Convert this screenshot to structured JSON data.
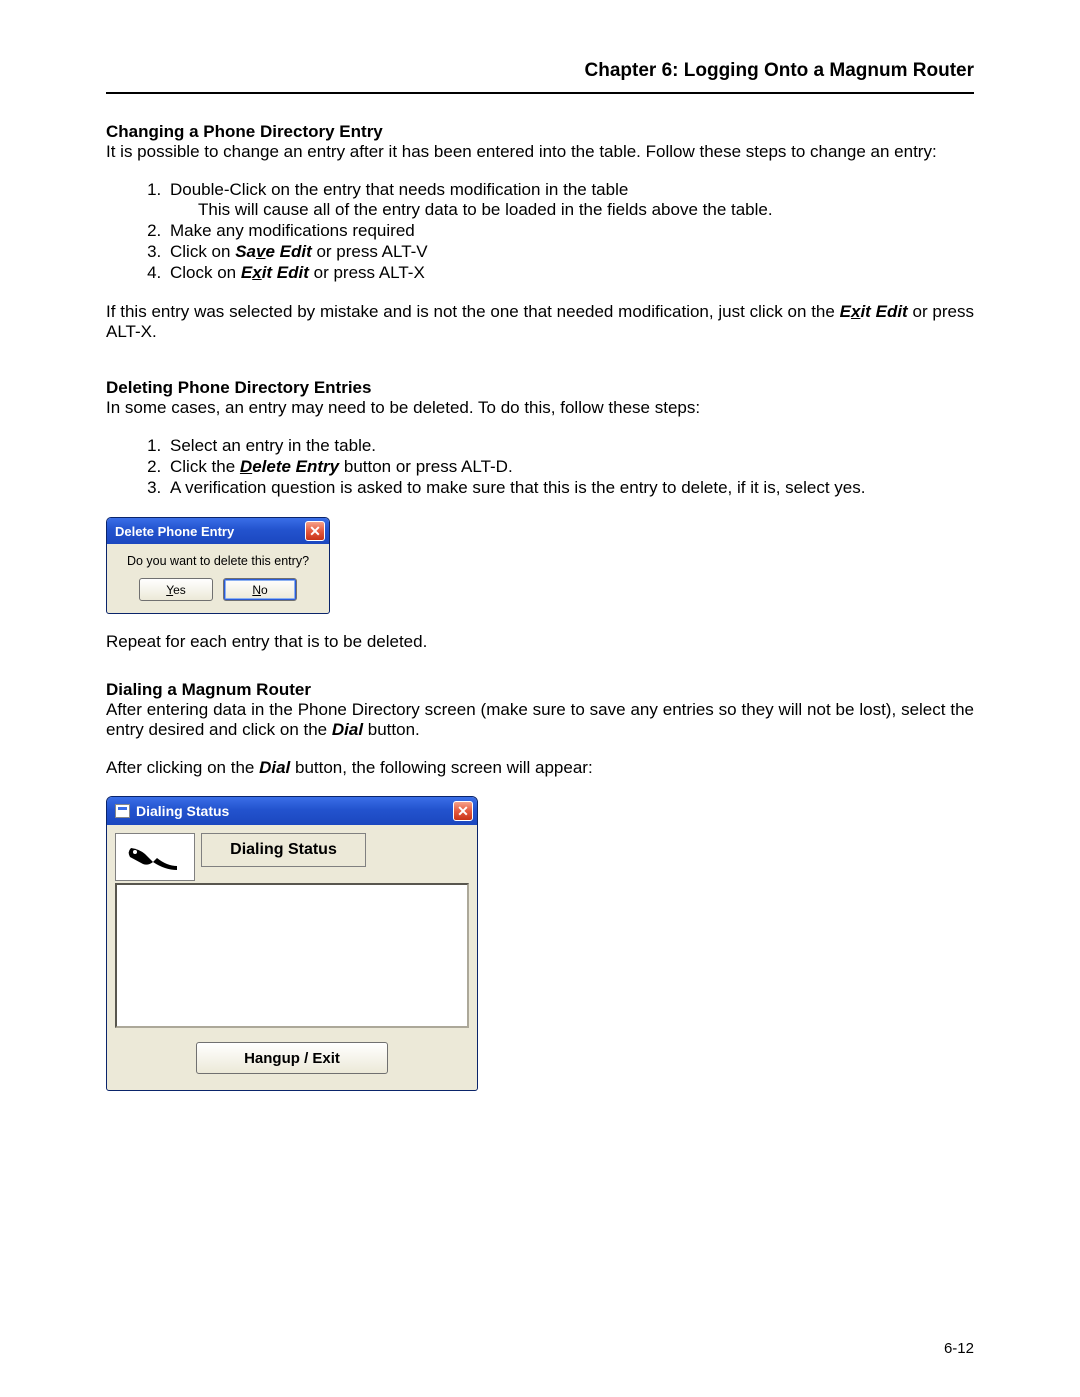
{
  "chapter": "Chapter 6: Logging Onto a Magnum Router",
  "s1": {
    "heading": "Changing a Phone Directory Entry",
    "intro": "It is possible to change an entry after it has been entered into the table.  Follow these steps to change an entry:",
    "li1": "Double-Click on the entry that needs modification in the table",
    "li1sub": "This will cause all of the entry data to be loaded in the fields above the table.",
    "li2": "Make any modifications required",
    "li3a": "Click on ",
    "li3b_pre": "Sa",
    "li3b_ak": "v",
    "li3b_post": "e Edit",
    "li3c": " or press ALT-V",
    "li4a": "Clock on ",
    "li4b_pre": "E",
    "li4b_ak": "x",
    "li4b_post": "it Edit",
    "li4c": " or press ALT-X",
    "note_a": "If this entry was selected by mistake and is not the one that needed modification, just click on the ",
    "note_b_pre": "E",
    "note_b_ak": "x",
    "note_b_post": "it Edit",
    "note_c": " or press ALT-X."
  },
  "s2": {
    "heading": "Deleting Phone Directory Entries",
    "intro": "In some cases, an entry may need to be deleted.  To do this, follow these steps:",
    "li1": "Select an entry in the table.",
    "li2a": "Click the ",
    "li2b_ak": "D",
    "li2b_post": "elete Entry",
    "li2c": " button or press ALT-D.",
    "li3": "A verification question is asked to make sure that this is the entry to delete, if it is, select yes.",
    "repeat": "Repeat for each entry that is to be deleted."
  },
  "dlg_delete": {
    "title": "Delete Phone Entry",
    "msg": "Do you want to delete this entry?",
    "yes_ak": "Y",
    "yes_rest": "es",
    "no_ak": "N",
    "no_rest": "o"
  },
  "s3": {
    "heading": "Dialing a Magnum Router",
    "p1a": "After entering data in the Phone Directory screen (make sure to save any entries so they will not be lost), select the entry desired and click on the ",
    "p1b": "Dial",
    "p1c": " button.",
    "p2a": "After clicking on the ",
    "p2b": "Dial",
    "p2c": " button, the following screen will appear:"
  },
  "dlg_dial": {
    "title": "Dialing Status",
    "label": "Dialing Status",
    "hangup": "Hangup / Exit"
  },
  "pagenum": "6-12"
}
